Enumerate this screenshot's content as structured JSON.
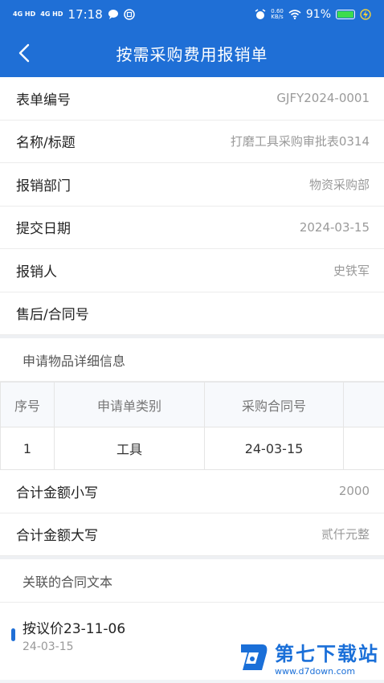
{
  "status": {
    "signal1": "4G HD",
    "signal2": "4G HD",
    "time": "17:18",
    "speed_value": "0.60",
    "speed_unit": "KB/s",
    "battery": "91%"
  },
  "nav": {
    "title": "按需采购费用报销单"
  },
  "form": [
    {
      "label": "表单编号",
      "value": "GJFY2024-0001"
    },
    {
      "label": "名称/标题",
      "value": "打磨工具采购审批表0314"
    },
    {
      "label": "报销部门",
      "value": "物资采购部"
    },
    {
      "label": "提交日期",
      "value": "2024-03-15"
    },
    {
      "label": "报销人",
      "value": "史铁军"
    },
    {
      "label": "售后/合同号",
      "value": ""
    }
  ],
  "details": {
    "title": "申请物品详细信息",
    "headers": [
      "序号",
      "申请单类别",
      "采购合同号",
      ""
    ],
    "rows": [
      [
        "1",
        "工具",
        "24-03-15",
        ""
      ]
    ]
  },
  "totals": [
    {
      "label": "合计金额小写",
      "value": "2000"
    },
    {
      "label": "合计金额大写",
      "value": "贰仟元整"
    }
  ],
  "contracts": {
    "title": "关联的合同文本",
    "items": [
      {
        "title": "按议价23-11-06",
        "date": "24-03-15"
      }
    ]
  },
  "watermark": {
    "name": "第七下载站",
    "url": "www.d7down.com"
  },
  "colors": {
    "primary": "#1f6fd6",
    "battery": "#3ddc4e"
  }
}
